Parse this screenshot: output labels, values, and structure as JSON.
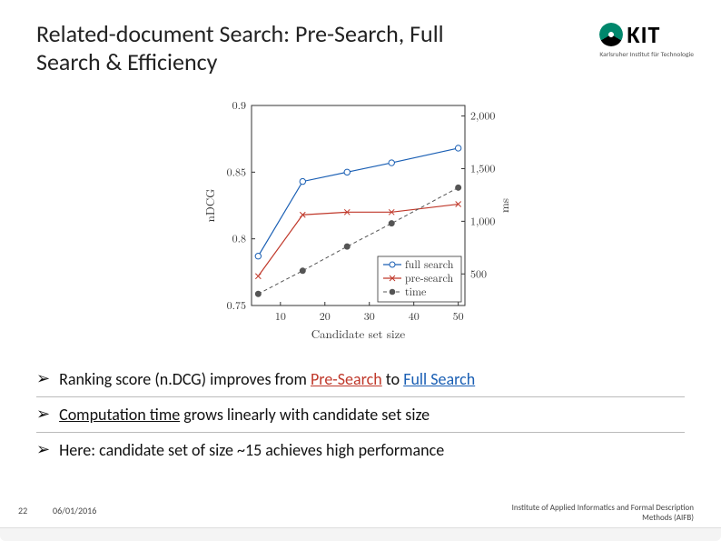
{
  "title": "Related-document Search: Pre-Search, Full Search & Efficiency",
  "logo": {
    "text": "KIT",
    "subtitle": "Karlsruher Institut für Technologie"
  },
  "chart_data": {
    "type": "line",
    "xlabel": "Candidate set size",
    "ylabel_left": "nDCG",
    "ylabel_right": "ms",
    "x": [
      5,
      15,
      25,
      35,
      50
    ],
    "x_ticks": [
      10,
      20,
      30,
      40,
      50
    ],
    "ylim_left": [
      0.75,
      0.9
    ],
    "yticks_left": [
      0.75,
      0.8,
      0.85,
      0.9
    ],
    "ylim_right": [
      200,
      2100
    ],
    "yticks_right": [
      500,
      1000,
      1500,
      2000
    ],
    "series": [
      {
        "name": "full search",
        "axis": "left",
        "values": [
          0.787,
          0.843,
          0.85,
          0.857,
          0.868
        ]
      },
      {
        "name": "pre-search",
        "axis": "left",
        "values": [
          0.772,
          0.818,
          0.82,
          0.82,
          0.826
        ]
      },
      {
        "name": "time",
        "axis": "right",
        "values": [
          310,
          530,
          760,
          980,
          1320
        ]
      }
    ],
    "legend_position": "inside-bottom-right"
  },
  "bullets": [
    {
      "prefix": "Ranking score (n.DCG) improves from ",
      "accent1": "Pre-Search",
      "mid": " to ",
      "accent2": "Full Search",
      "suffix": ""
    },
    {
      "prefix": "",
      "accent1": "Computation time",
      "mid": " grows linearly with candidate set size",
      "accent2": "",
      "suffix": ""
    },
    {
      "prefix": "Here: candidate set of size ~15 achieves high performance",
      "accent1": "",
      "mid": "",
      "accent2": "",
      "suffix": ""
    }
  ],
  "footer": {
    "page": "22",
    "date": "06/01/2016",
    "right_line1": "Institute of Applied Informatics and Formal Description",
    "right_line2": "Methods (AIFB)"
  }
}
